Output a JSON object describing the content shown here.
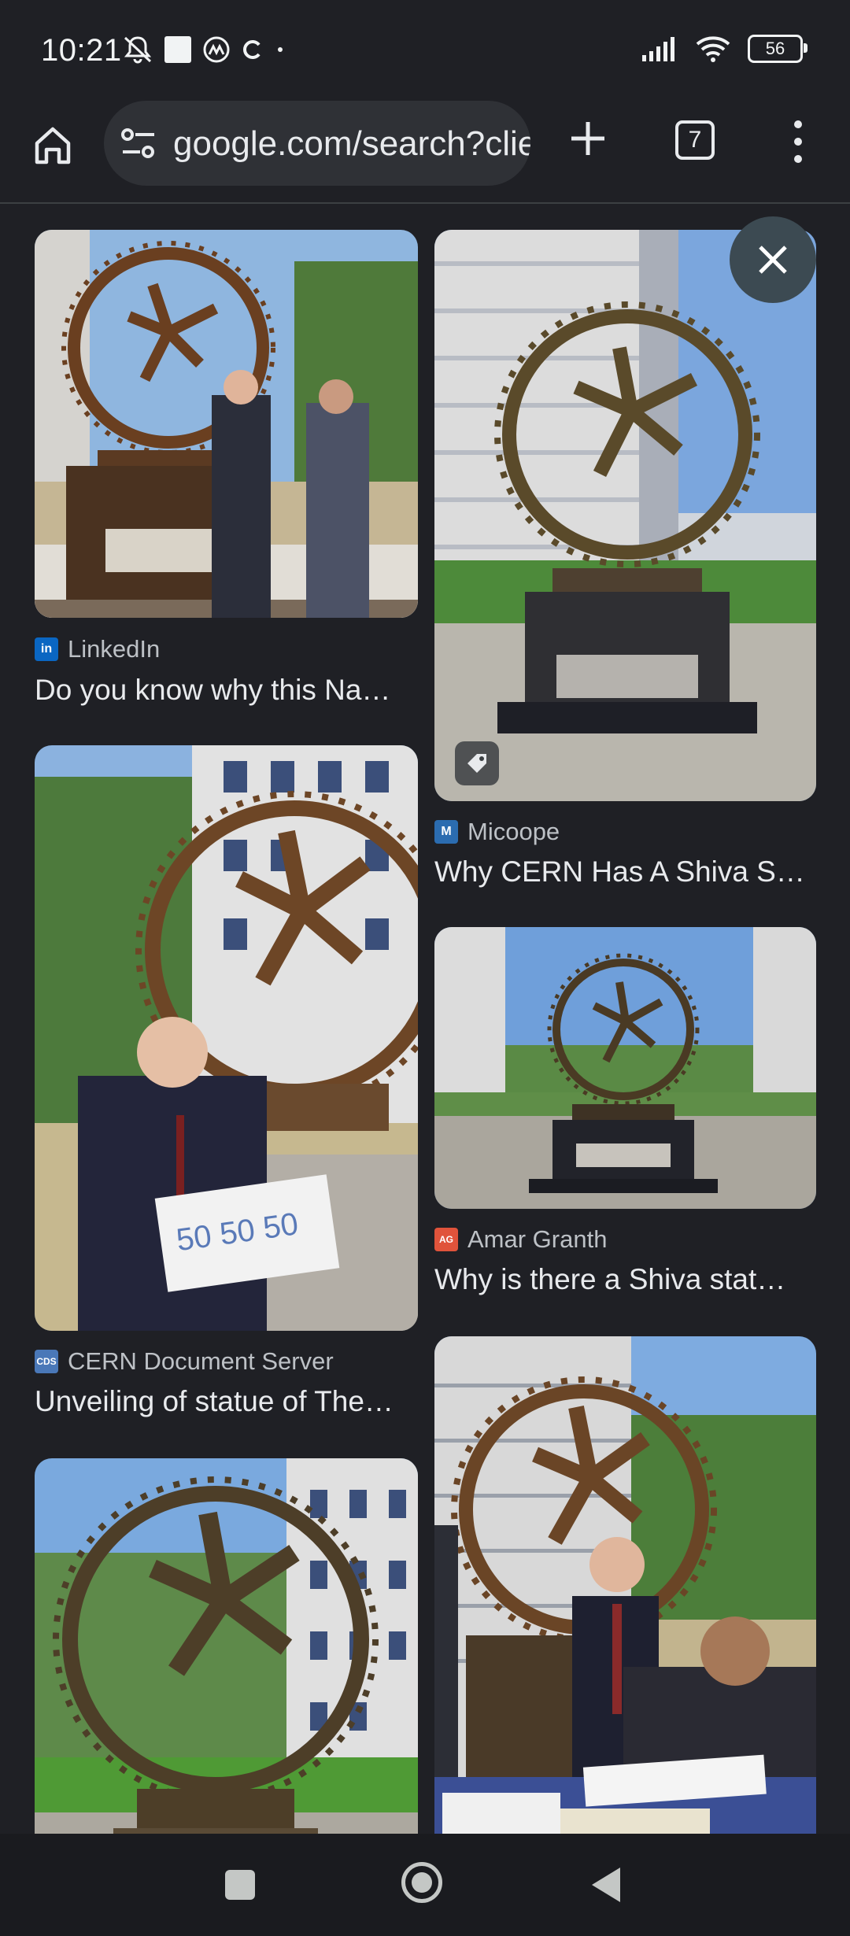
{
  "status_bar": {
    "time": "10:21",
    "battery": "56"
  },
  "toolbar": {
    "url": "google.com/search?client=ms-android-xiaomi",
    "tab_count": "7"
  },
  "results": [
    {
      "source": "LinkedIn",
      "favicon": "in",
      "caption": "Do you know why this Na…"
    },
    {
      "source": "Micoope",
      "favicon": "M",
      "caption": "Why CERN Has A Shiva S…"
    },
    {
      "source": "CERN Document Server",
      "favicon": "CDS",
      "caption": "Unveiling of statue of The…"
    },
    {
      "source": "Amar Granth",
      "favicon": "AG",
      "caption": "Why is there a Shiva stat…"
    }
  ],
  "colors": {
    "background": "#1f2025",
    "linkedin": "#0a66c2",
    "micoope": "#2b6cb0",
    "cds": "#4a78b8",
    "amar_granth": "#e0533b"
  }
}
